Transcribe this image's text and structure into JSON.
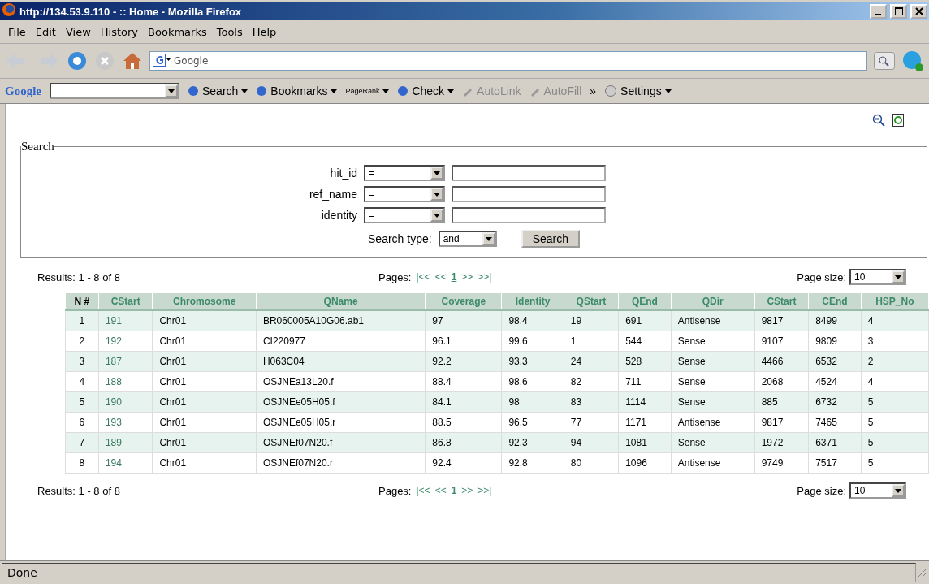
{
  "window": {
    "title": "http://134.53.9.110 - :: Home - Mozilla Firefox"
  },
  "menu": [
    "File",
    "Edit",
    "View",
    "History",
    "Bookmarks",
    "Tools",
    "Help"
  ],
  "address_bar": {
    "value": "Google"
  },
  "google_toolbar": {
    "brand": "Google",
    "items": [
      {
        "label": "Search",
        "kind": "dropdown",
        "disabled": false
      },
      {
        "label": "Bookmarks",
        "kind": "dropdown",
        "disabled": false
      },
      {
        "label": "PageRank",
        "kind": "rank",
        "disabled": false
      },
      {
        "label": "Check",
        "kind": "dropdown",
        "disabled": false
      },
      {
        "label": "AutoLink",
        "kind": "plain",
        "disabled": true
      },
      {
        "label": "AutoFill",
        "kind": "plain",
        "disabled": true
      },
      {
        "label": "»",
        "kind": "more",
        "disabled": false
      },
      {
        "label": "Settings",
        "kind": "settings",
        "disabled": false
      }
    ]
  },
  "search": {
    "legend": "Search",
    "fields": [
      {
        "label": "hit_id",
        "operator": "="
      },
      {
        "label": "ref_name",
        "operator": "="
      },
      {
        "label": "identity",
        "operator": "="
      }
    ],
    "search_type_label": "Search type:",
    "search_type": "and",
    "button": "Search"
  },
  "results_bars": [
    {
      "summary": "Results: 1 - 8 of 8",
      "pages_label": "Pages:",
      "pager": [
        {
          "label": "|<<",
          "selected": false
        },
        {
          "label": "<<",
          "selected": false
        },
        {
          "label": "1",
          "selected": true
        },
        {
          "label": ">>",
          "selected": false
        },
        {
          "label": ">>|",
          "selected": false
        }
      ],
      "page_size_label": "Page size:",
      "page_size": "10"
    },
    {
      "summary": "Results: 1 - 8 of 8",
      "pages_label": "Pages:",
      "pager": [
        {
          "label": "|<<",
          "selected": false
        },
        {
          "label": "<<",
          "selected": false
        },
        {
          "label": "1",
          "selected": true
        },
        {
          "label": ">>",
          "selected": false
        },
        {
          "label": ">>|",
          "selected": false
        }
      ],
      "page_size_label": "Page size:",
      "page_size": "10"
    }
  ],
  "table": {
    "columns": [
      "N #",
      "CStart",
      "Chromosome",
      "QName",
      "Coverage",
      "Identity",
      "QStart",
      "QEnd",
      "QDir",
      "CStart",
      "CEnd",
      "HSP_No"
    ],
    "rows": [
      [
        "1",
        "191",
        "Chr01",
        "BR060005A10G06.ab1",
        "97",
        "98.4",
        "19",
        "691",
        "Antisense",
        "9817",
        "8499",
        "4"
      ],
      [
        "2",
        "192",
        "Chr01",
        "CI220977",
        "96.1",
        "99.6",
        "1",
        "544",
        "Sense",
        "9107",
        "9809",
        "3"
      ],
      [
        "3",
        "187",
        "Chr01",
        "H063C04",
        "92.2",
        "93.3",
        "24",
        "528",
        "Sense",
        "4466",
        "6532",
        "2"
      ],
      [
        "4",
        "188",
        "Chr01",
        "OSJNEa13L20.f",
        "88.4",
        "98.6",
        "82",
        "711",
        "Sense",
        "2068",
        "4524",
        "4"
      ],
      [
        "5",
        "190",
        "Chr01",
        "OSJNEe05H05.f",
        "84.1",
        "98",
        "83",
        "1114",
        "Sense",
        "885",
        "6732",
        "5"
      ],
      [
        "6",
        "193",
        "Chr01",
        "OSJNEe05H05.r",
        "88.5",
        "96.5",
        "77",
        "1171",
        "Antisense",
        "9817",
        "7465",
        "5"
      ],
      [
        "7",
        "189",
        "Chr01",
        "OSJNEf07N20.f",
        "86.8",
        "92.3",
        "94",
        "1081",
        "Sense",
        "1972",
        "6371",
        "5"
      ],
      [
        "8",
        "194",
        "Chr01",
        "OSJNEf07N20.r",
        "92.4",
        "92.8",
        "80",
        "1096",
        "Antisense",
        "9749",
        "7517",
        "5"
      ]
    ]
  },
  "status_bar": "Done"
}
